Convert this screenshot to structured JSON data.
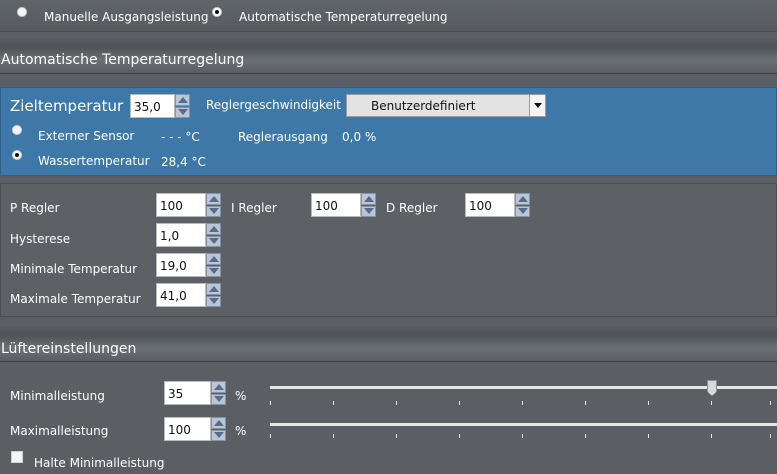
{
  "mode": {
    "manual_label": "Manuelle Ausgangsleistung",
    "auto_label": "Automatische Temperaturregelung",
    "selected": "auto"
  },
  "auto_section": {
    "header": "Automatische Temperaturregelung",
    "target_label": "Zieltemperatur",
    "target_value": "35,0",
    "speed_label": "Reglergeschwindigkeit",
    "speed_value": "Benutzerdefiniert",
    "external_label": "Externer Sensor",
    "external_value": "- - - °C",
    "water_label": "Wassertemperatur",
    "water_value": "28,4 °C",
    "output_label": "Reglerausgang",
    "output_value": "0,0 %",
    "sensor_selected": "water"
  },
  "pid": {
    "p_label": "P Regler",
    "p_value": "100",
    "i_label": "I Regler",
    "i_value": "100",
    "d_label": "D Regler",
    "d_value": "100",
    "hyst_label": "Hysterese",
    "hyst_value": "1,0",
    "min_label": "Minimale Temperatur",
    "min_value": "19,0",
    "max_label": "Maximale Temperatur",
    "max_value": "41,0"
  },
  "fan": {
    "header": "Lüftereinstellungen",
    "min_label": "Minimalleistung",
    "min_value": "35",
    "max_label": "Maximalleistung",
    "max_value": "100",
    "unit": "%",
    "hold_label": "Halte Minimalleistung",
    "hold_checked": false
  },
  "colors": {
    "panel_blue": "#3d78a8",
    "background": "#5b5f63"
  }
}
